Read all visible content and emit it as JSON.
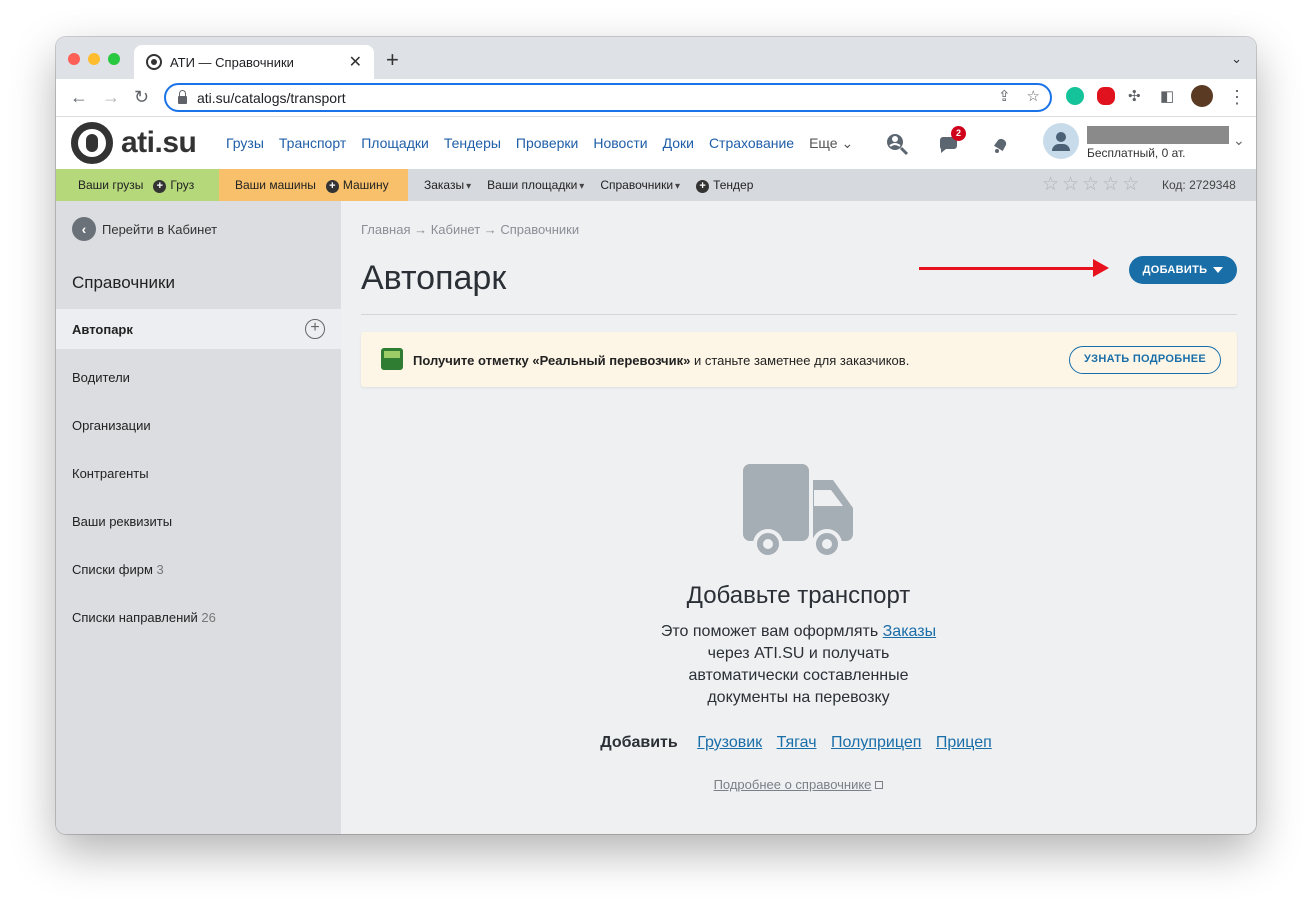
{
  "browser": {
    "tab_title": "АТИ — Справочники",
    "url": "ati.su/catalogs/transport"
  },
  "header": {
    "logo_text": "ati.su",
    "nav": [
      "Грузы",
      "Транспорт",
      "Площадки",
      "Тендеры",
      "Проверки",
      "Новости",
      "Доки",
      "Страхование",
      "Еще"
    ],
    "messages_badge": "2",
    "user_plan": "Бесплатный,   0 ат."
  },
  "subnav": {
    "cargo_label": "Ваши грузы",
    "add_cargo": "Груз",
    "trucks_label": "Ваши машины",
    "add_truck": "Машину",
    "orders": "Заказы",
    "areas": "Ваши площадки",
    "catalogs": "Справочники",
    "tender": "Тендер",
    "code": "Код: 2729348",
    "rating_stars": 0
  },
  "sidebar": {
    "back": "Перейти в Кабинет",
    "title": "Справочники",
    "active": "Автопарк",
    "items": [
      {
        "label": "Водители",
        "count": ""
      },
      {
        "label": "Организации",
        "count": ""
      },
      {
        "label": "Контрагенты",
        "count": ""
      },
      {
        "label": "Ваши реквизиты",
        "count": ""
      },
      {
        "label": "Списки фирм",
        "count": "3"
      },
      {
        "label": "Списки направлений",
        "count": "26"
      }
    ]
  },
  "main": {
    "breadcrumb": "Главная → Кабинет → Справочники",
    "title": "Автопарк",
    "add_button": "ДОБАВИТЬ",
    "banner_bold": "Получите отметку «Реальный перевозчик»",
    "banner_rest": " и станьте заметнее для заказчиков.",
    "banner_button": "УЗНАТЬ ПОДРОБНЕЕ",
    "empty_title": "Добавьте транспорт",
    "empty_desc_1": "Это поможет вам оформлять ",
    "empty_desc_link": "Заказы",
    "empty_desc_2": "через ATI.SU и получать",
    "empty_desc_3": "автоматически составленные",
    "empty_desc_4": "документы на перевозку",
    "add_label": "Добавить",
    "add_links": [
      "Грузовик",
      "Тягач",
      "Полуприцеп",
      "Прицеп"
    ],
    "about_link": "Подробнее о справочнике"
  },
  "colors": {
    "accent": "#1a6ea8",
    "cargo_bg": "#b5d87a",
    "trucks_bg": "#f8c06b",
    "arrow": "#e8121e"
  }
}
